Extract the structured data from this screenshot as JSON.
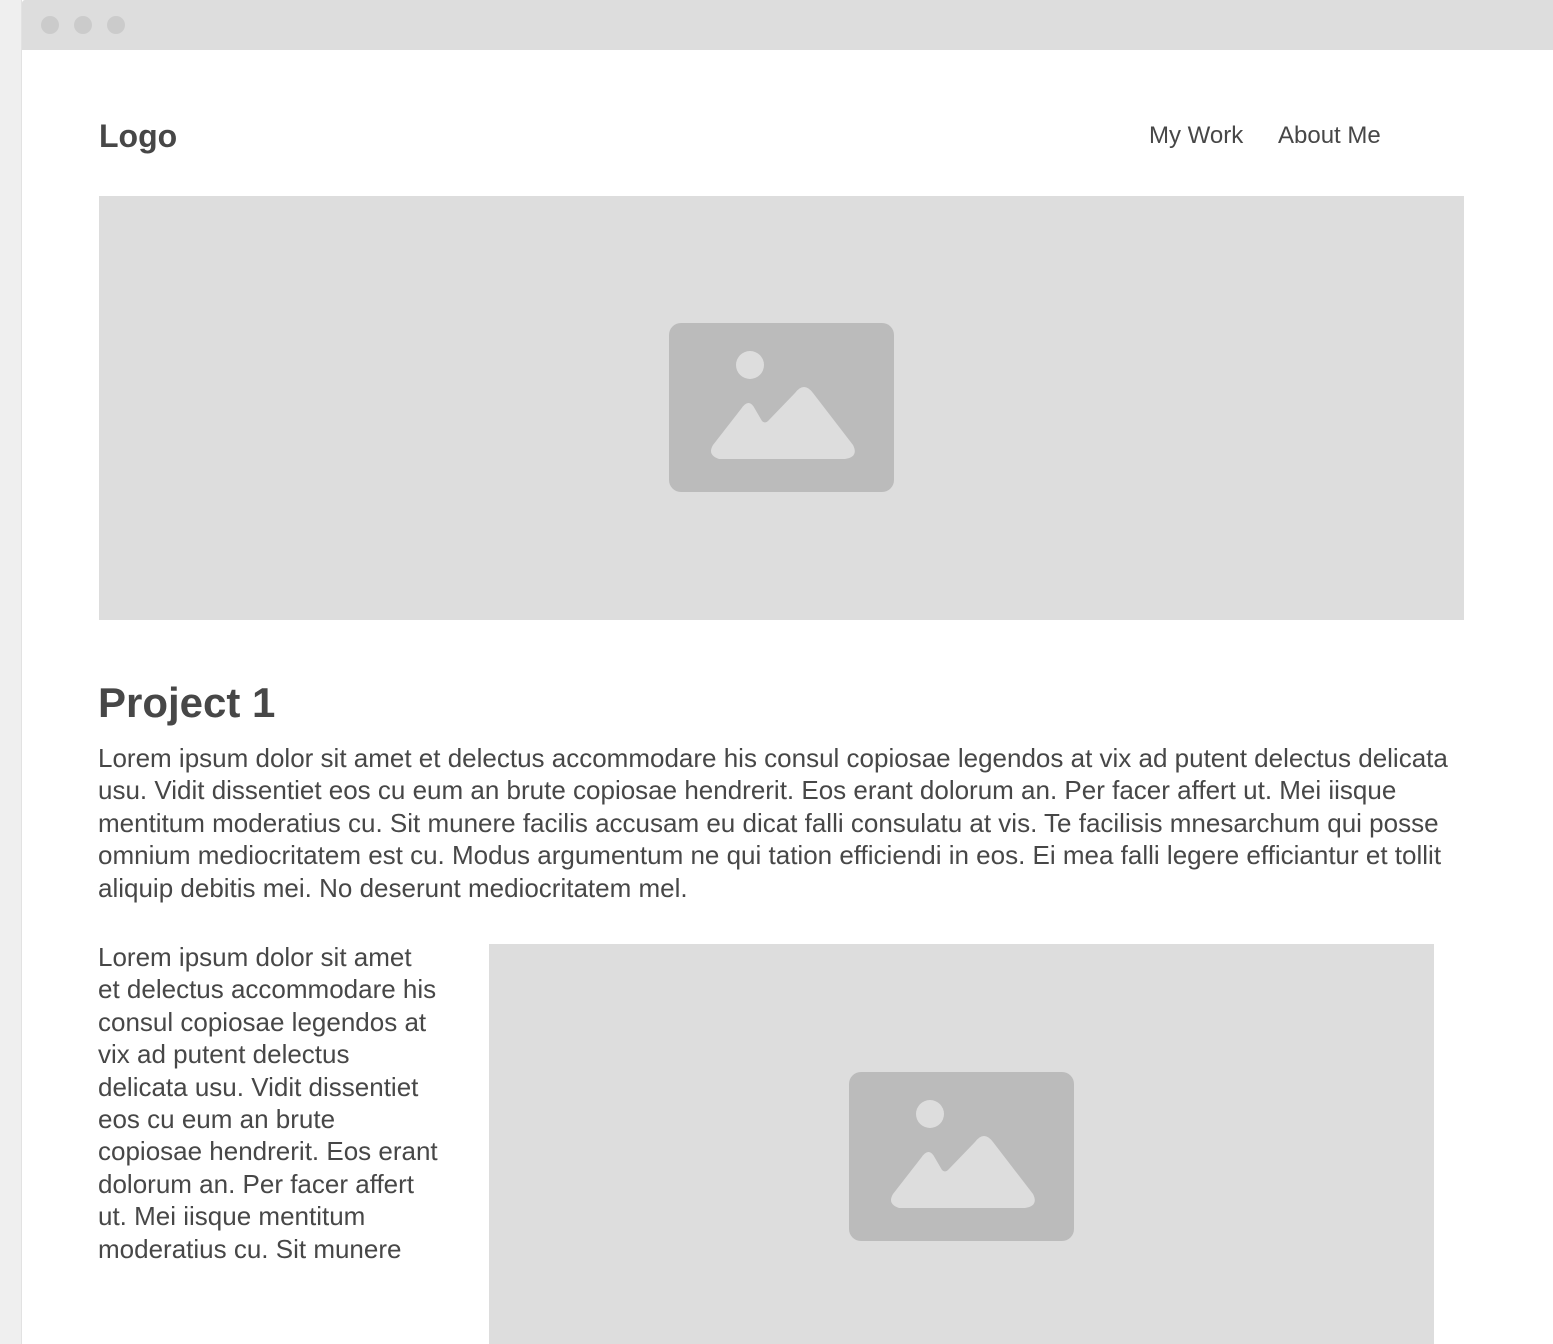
{
  "header": {
    "logo": "Logo",
    "nav": [
      "My Work",
      "About Me"
    ]
  },
  "hero": {
    "icon": "image-placeholder-icon"
  },
  "project": {
    "title": "Project 1",
    "description": "Lorem ipsum dolor sit amet et delectus accommodare his consul copiosae legendos at vix ad putent delectus delicata usu. Vidit dissentiet eos cu eum an brute copiosae hendrerit. Eos erant dolorum an. Per facer affert ut. Mei iisque mentitum moderatius cu. Sit munere facilis accusam eu dicat falli consulatu at vis. Te facilisis mnesarchum qui posse omnium mediocritatem est cu. Modus argumentum ne qui tation efficiendi in eos. Ei mea falli legere efficiantur et tollit aliquip debitis mei. No deserunt mediocritatem mel.",
    "side_text": "Lorem ipsum dolor sit amet et delectus accommodare his consul copiosae legendos at vix ad putent delectus delicata usu. Vidit dissentiet eos cu eum an brute copiosae hendrerit. Eos erant dolorum an. Per facer affert ut. Mei iisque mentitum moderatius cu. Sit munere",
    "image_icon": "image-placeholder-icon"
  },
  "colors": {
    "placeholder_bg": "#dddddd",
    "placeholder_icon": "#bbbbbb",
    "text": "#474747",
    "titlebar": "#dddddd"
  }
}
